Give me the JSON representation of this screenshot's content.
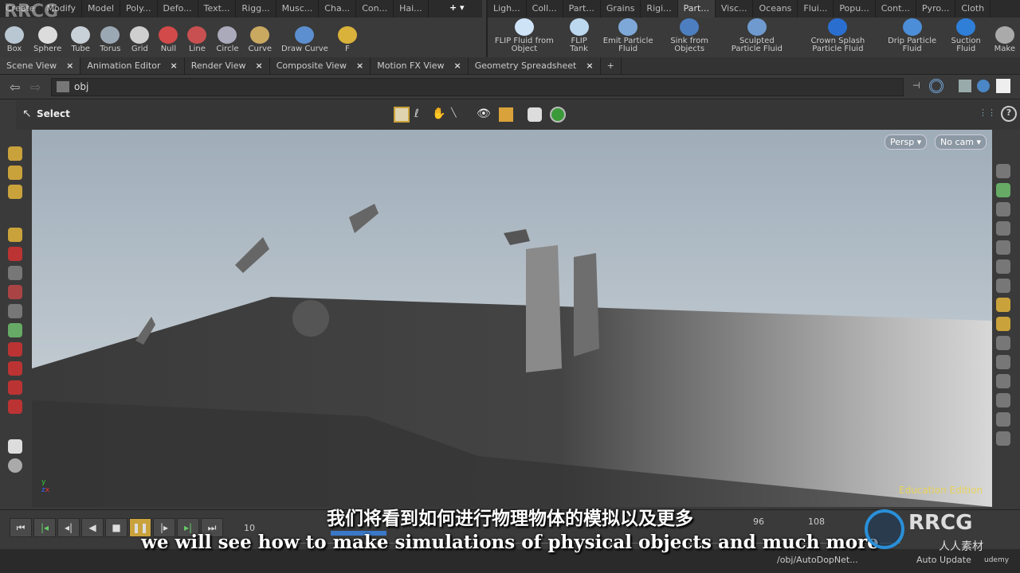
{
  "watermark": "RRCG",
  "left_shelf": {
    "tabs": [
      "Create",
      "Modify",
      "Model",
      "Poly...",
      "Defo...",
      "Text...",
      "Rigg...",
      "Musc...",
      "Cha...",
      "Con...",
      "Hai..."
    ],
    "tools": [
      {
        "label": "Box",
        "color": "#b9c7d3"
      },
      {
        "label": "Sphere",
        "color": "#dcdcdc"
      },
      {
        "label": "Tube",
        "color": "#c8d0d8"
      },
      {
        "label": "Torus",
        "color": "#9aa8b4"
      },
      {
        "label": "Grid",
        "color": "#cfcfcf"
      },
      {
        "label": "Null",
        "color": "#d24a4a"
      },
      {
        "label": "Line",
        "color": "#c85050"
      },
      {
        "label": "Circle",
        "color": "#aab"
      },
      {
        "label": "Curve",
        "color": "#c9a860"
      },
      {
        "label": "Draw Curve",
        "color": "#5c8fd0"
      },
      {
        "label": "F",
        "color": "#d8b23a"
      }
    ]
  },
  "right_shelf": {
    "tabs": [
      "Ligh...",
      "Coll...",
      "Part...",
      "Grains",
      "Rigi...",
      "Part...",
      "Visc...",
      "Oceans",
      "Flui...",
      "Popu...",
      "Cont...",
      "Pyro...",
      "Cloth"
    ],
    "active_tab": 5,
    "tools": [
      {
        "label": "FLIP Fluid from Object",
        "color": "#cfe3f7"
      },
      {
        "label": "FLIP Tank",
        "color": "#bcd8ef"
      },
      {
        "label": "Emit Particle Fluid",
        "color": "#7ea8d8"
      },
      {
        "label": "Sink from Objects",
        "color": "#4d7fc0"
      },
      {
        "label": "Sculpted Particle Fluid",
        "color": "#6f9ad0"
      },
      {
        "label": "Crown Splash Particle Fluid",
        "color": "#2a6fd0"
      },
      {
        "label": "Drip Particle Fluid",
        "color": "#4c8ed8"
      },
      {
        "label": "Suction Fluid",
        "color": "#2f7fd8"
      },
      {
        "label": "Make",
        "color": "#aaa"
      }
    ]
  },
  "pane_tabs": [
    "Scene View",
    "Animation Editor",
    "Render View",
    "Composite View",
    "Motion FX View",
    "Geometry Spreadsheet"
  ],
  "path": "obj",
  "tool_label": "Select",
  "viewport": {
    "camera_menu": "Persp",
    "cam_menu": "No cam",
    "edition": "Education Edition",
    "sky_top": "#9fadb9",
    "sky_bottom": "#d3d9dd",
    "ground": "#3d3d3d"
  },
  "timeline": {
    "frame": "10",
    "ticks": [
      "96",
      "108"
    ]
  },
  "subtitles": {
    "zh": "我们将看到如何进行物理物体的模拟以及更多",
    "en": "we will see how to make simulations of physical objects and much more"
  },
  "status": {
    "path": "/obj/AutoDopNet...",
    "update": "Auto Update",
    "udemy": "udemy"
  },
  "logo": {
    "text": "RRCG",
    "sub": "人人素材"
  }
}
